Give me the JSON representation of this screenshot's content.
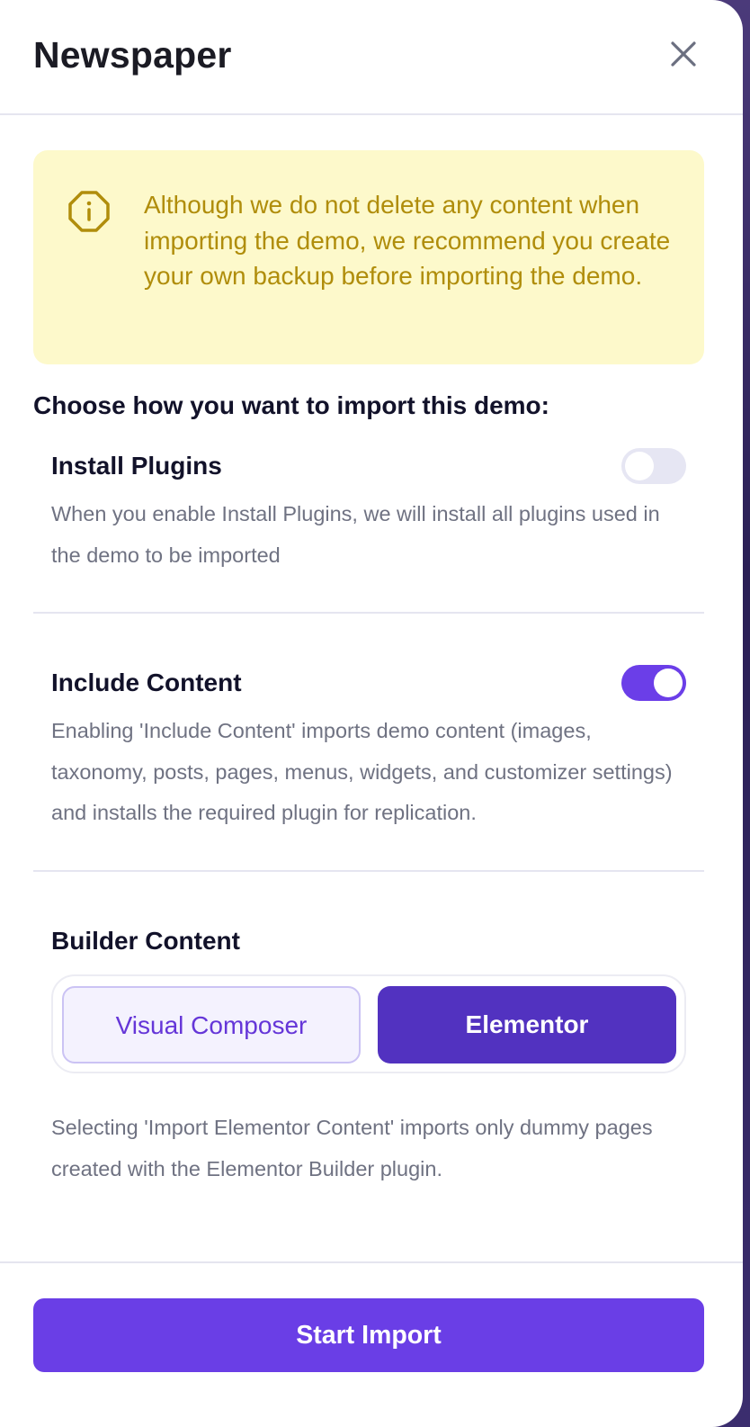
{
  "dialog": {
    "title": "Newspaper"
  },
  "notice": {
    "icon": "info-octagon-icon",
    "text": "Although we do not delete any content when importing the demo, we recommend you create your own backup before importing the demo."
  },
  "options_heading": "Choose how you want to import this demo:",
  "install_plugins": {
    "title": "Install Plugins",
    "description": "When you enable Install Plugins, we will install all plugins used in the demo to be imported",
    "enabled": false
  },
  "include_content": {
    "title": "Include Content",
    "description": "Enabling 'Include Content' imports demo content (images, taxonomy, posts, pages, menus, widgets, and customizer settings) and installs the required plugin for replication.",
    "enabled": true
  },
  "builder_content": {
    "title": "Builder Content",
    "options": [
      "Visual Composer",
      "Elementor"
    ],
    "selected": "Elementor",
    "description": "Selecting 'Import Elementor Content' imports only dummy pages created with the Elementor Builder plugin."
  },
  "footer": {
    "start_label": "Start Import"
  },
  "colors": {
    "accent": "#6a3ee6",
    "notice_bg": "#fdf9cb",
    "notice_text": "#b08d0b"
  }
}
